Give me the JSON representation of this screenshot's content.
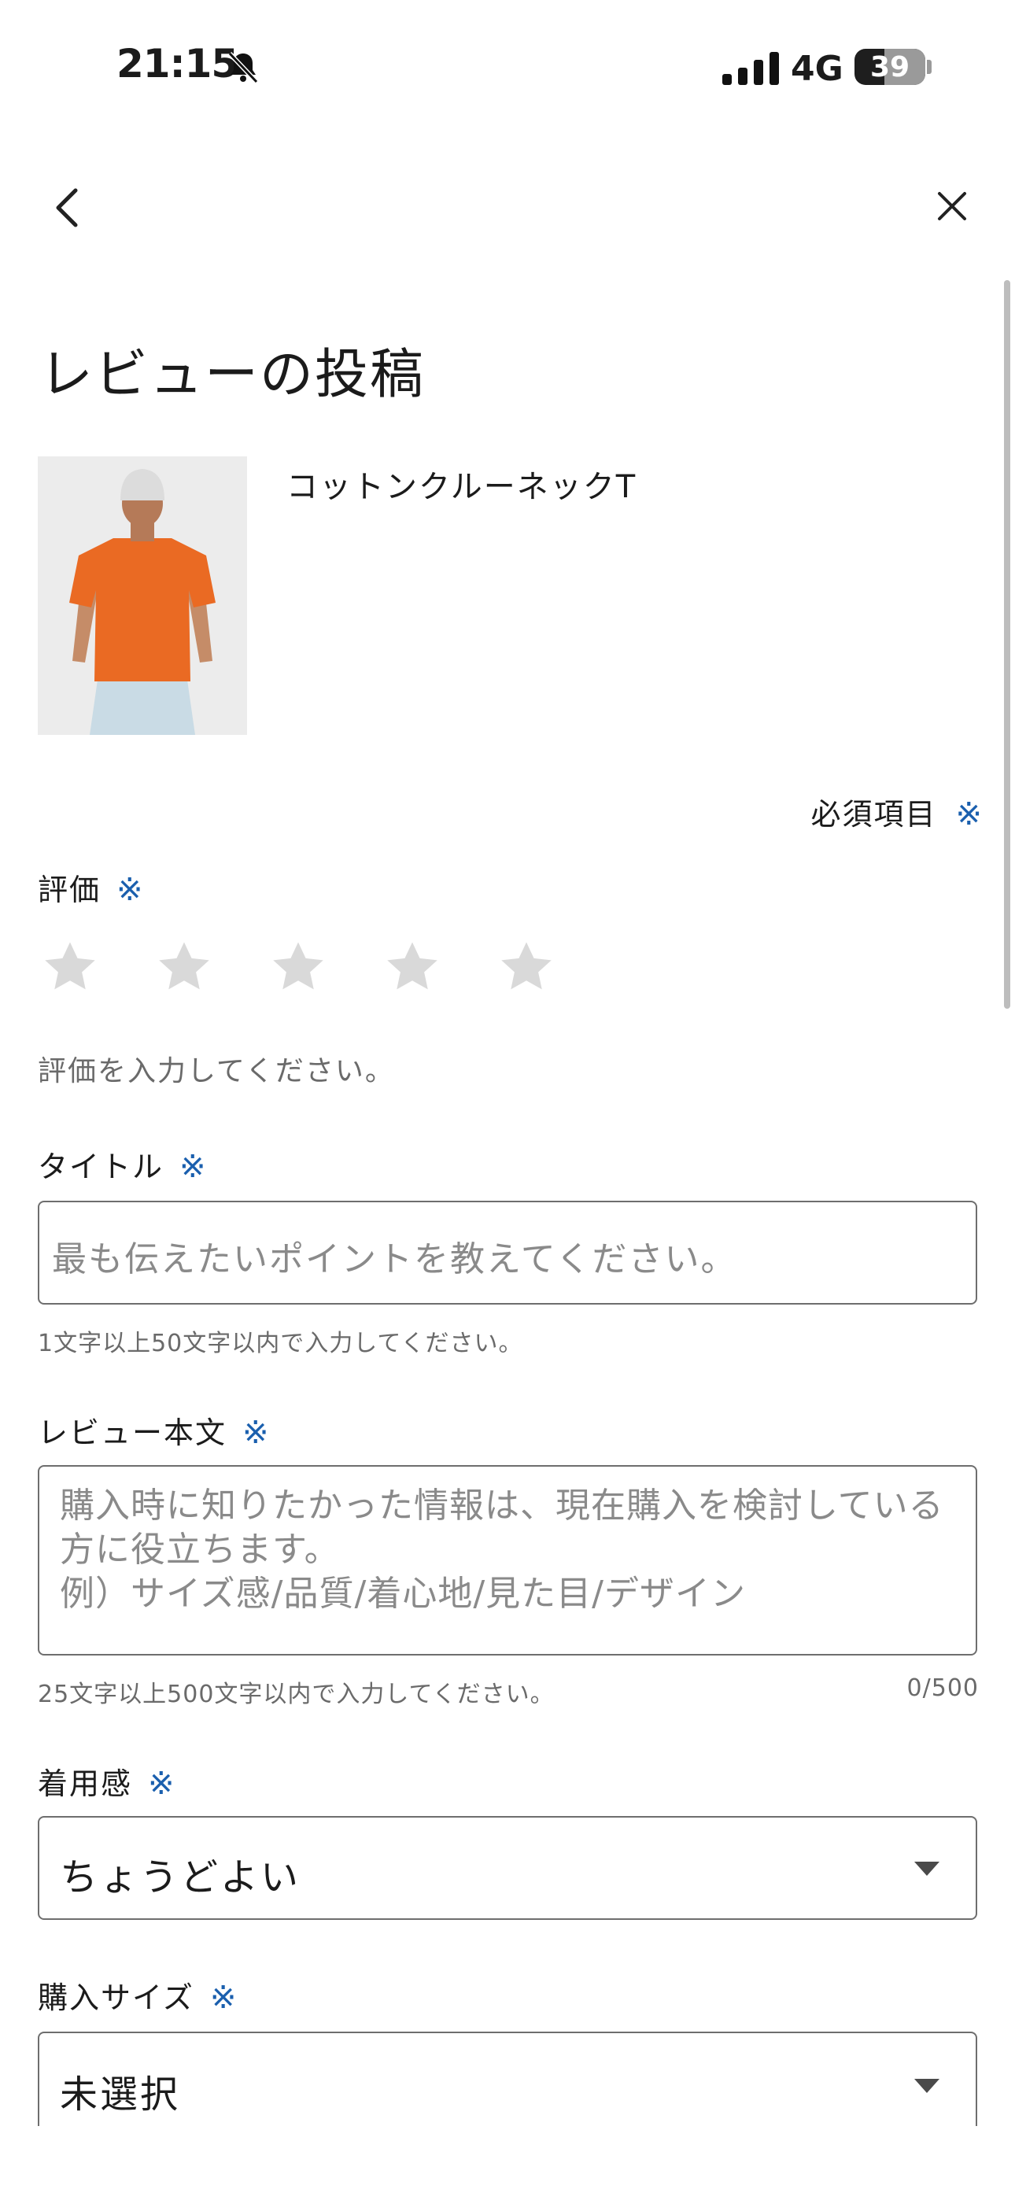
{
  "status_bar": {
    "time": "21:15",
    "network": "4G",
    "battery": "39"
  },
  "header": {
    "back_icon": "chevron-left-icon",
    "close_icon": "close-icon"
  },
  "page_title": "レビューの投稿",
  "product": {
    "name": "コットンクルーネックT",
    "image_desc_icon": "product-photo"
  },
  "required_note": {
    "text": "必須項目",
    "mark": "※"
  },
  "rating": {
    "label": "評価",
    "mark": "※",
    "stars_total": 5,
    "stars_selected": 0,
    "hint": "評価を入力してください。"
  },
  "title_field": {
    "label": "タイトル",
    "mark": "※",
    "placeholder": "最も伝えたいポイントを教えてください。",
    "hint": "1文字以上50文字以内で入力してください。"
  },
  "review_body": {
    "label": "レビュー本文",
    "mark": "※",
    "placeholder": "購入時に知りたかった情報は、現在購入を検討している方に役立ちます。\n例）サイズ感/品質/着心地/見た目/デザイン",
    "hint": "25文字以上500文字以内で入力してください。",
    "counter": "0/500"
  },
  "fit": {
    "label": "着用感",
    "mark": "※",
    "value": "ちょうどよい"
  },
  "purchase_size": {
    "label": "購入サイズ",
    "mark": "※",
    "value": "未選択"
  },
  "colors": {
    "accent": "#1a5fae",
    "star_empty": "#d9d9d9",
    "shirt": "#ea6a23"
  }
}
